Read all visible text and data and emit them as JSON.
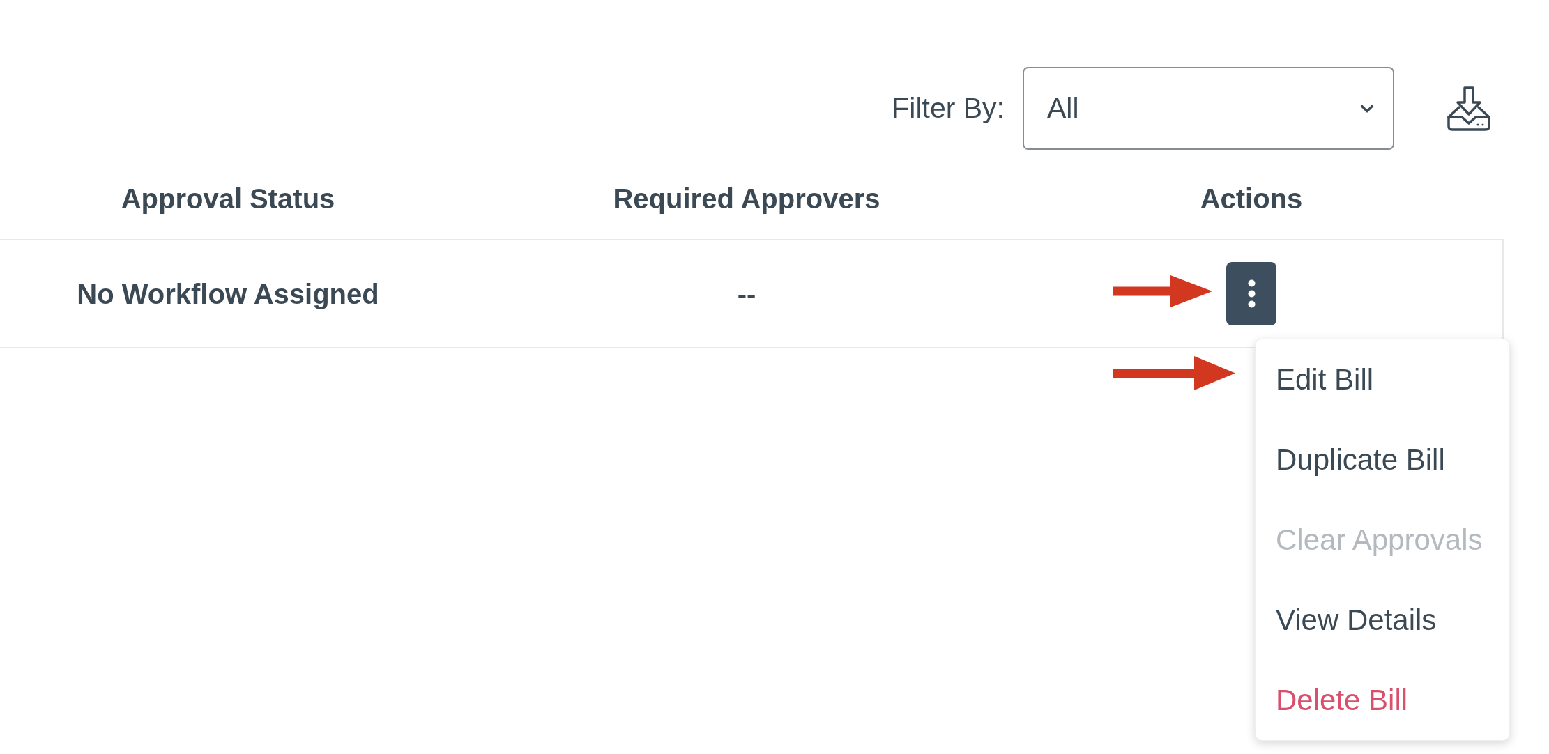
{
  "toolbar": {
    "filter_label": "Filter By:",
    "filter_select": {
      "value": "All"
    }
  },
  "table": {
    "columns": [
      "Approval Status",
      "Required Approvers",
      "Actions"
    ],
    "rows": [
      {
        "cells": [
          "No Workflow Assigned",
          "--"
        ]
      }
    ]
  },
  "actions_menu": {
    "expanded": true,
    "items": [
      {
        "label": "Edit Bill",
        "kind": "action",
        "disabled": false
      },
      {
        "label": "Duplicate Bill",
        "kind": "action",
        "disabled": false
      },
      {
        "label": "Clear Approvals",
        "kind": "action",
        "disabled": true
      },
      {
        "label": "View Details",
        "kind": "action",
        "disabled": false
      },
      {
        "label": "Delete Bill",
        "kind": "danger",
        "disabled": false
      }
    ]
  }
}
